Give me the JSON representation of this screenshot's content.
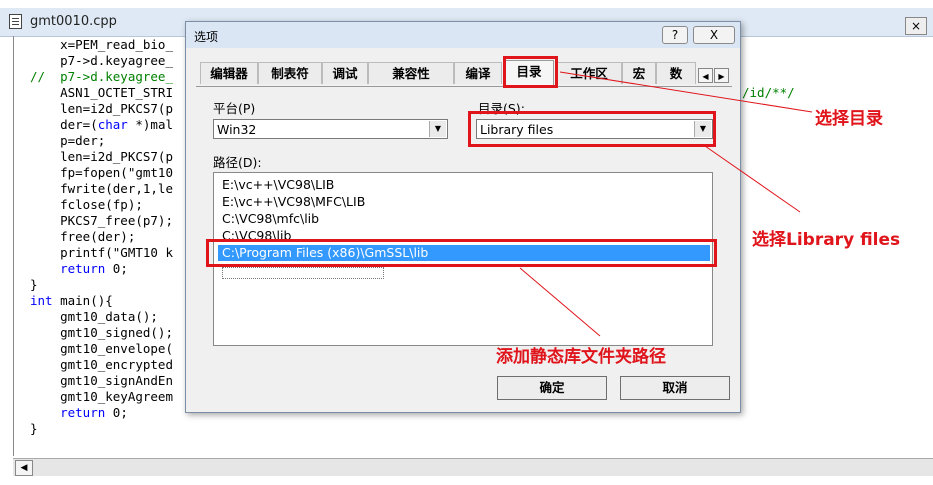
{
  "editor": {
    "title": "gmt0010.cpp",
    "close_label": "×",
    "code_lines": [
      {
        "text": "    x=PEM_read_bio_",
        "comment": false
      },
      {
        "text": "    p7->d.keyagree_",
        "comment": false
      },
      {
        "text": "//  p7->d.keyagree_",
        "comment": true
      },
      {
        "text": "    ASN1_OCTET_STRI",
        "comment": false
      },
      {
        "text": "    len=i2d_PKCS7(p",
        "comment": false
      },
      {
        "text": "    der=(char *)mal",
        "comment": false
      },
      {
        "text": "    p=der;",
        "comment": false
      },
      {
        "text": "    len=i2d_PKCS7(p",
        "comment": false
      },
      {
        "text": "    fp=fopen(\"gmt10",
        "comment": false
      },
      {
        "text": "    fwrite(der,1,le",
        "comment": false
      },
      {
        "text": "    fclose(fp);",
        "comment": false
      },
      {
        "text": "    PKCS7_free(p7);",
        "comment": false
      },
      {
        "text": "    free(der);",
        "comment": false
      },
      {
        "text": "    printf(\"GMT10 k",
        "comment": false
      },
      {
        "text": "    return 0;",
        "comment": false
      },
      {
        "text": "}",
        "comment": false
      },
      {
        "text": "int main(){",
        "comment": false
      },
      {
        "text": "    gmt10_data();",
        "comment": false
      },
      {
        "text": "    gmt10_signed();",
        "comment": false
      },
      {
        "text": "    gmt10_envelope(",
        "comment": false
      },
      {
        "text": "    gmt10_encrypted",
        "comment": false
      },
      {
        "text": "    gmt10_signAndEn",
        "comment": false
      },
      {
        "text": "    gmt10_keyAgreem",
        "comment": false
      },
      {
        "text": "    return 0;",
        "comment": false
      },
      {
        "text": "}",
        "comment": false
      }
    ],
    "right_fragment": "/id/**/"
  },
  "dialog": {
    "title": "选项",
    "help_label": "?",
    "close_label": "X",
    "tabs": [
      "编辑器",
      "制表符",
      "调试",
      "兼容性",
      "编译",
      "目录",
      "工作区",
      "宏",
      "数"
    ],
    "active_tab": "目录",
    "platform_label": "平台(P)",
    "platform_value": "Win32",
    "directory_label": "目录(S):",
    "directory_value": "Library files",
    "paths_label": "路径(D):",
    "paths": [
      "E:\\vc++\\VC98\\LIB",
      "E:\\vc++\\VC98\\MFC\\LIB",
      "C:\\VC98\\mfc\\lib",
      "C:\\VC98\\lib",
      "C:\\Program Files (x86)\\GmSSL\\lib"
    ],
    "ok_label": "确定",
    "cancel_label": "取消"
  },
  "annotations": {
    "select_dir": "选择目录",
    "select_lib": "选择Library files",
    "add_path": "添加静态库文件夹路径",
    "color": "#e0141b"
  }
}
